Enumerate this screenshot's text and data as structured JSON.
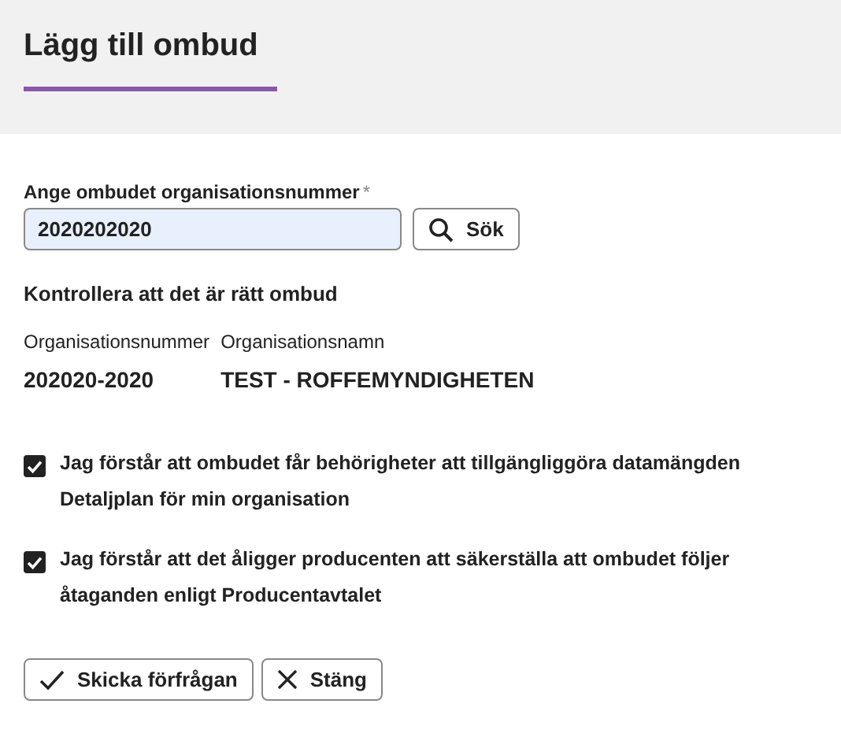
{
  "header": {
    "title": "Lägg till ombud"
  },
  "search": {
    "label": "Ange ombudet organisationsnummer",
    "required_mark": "*",
    "value": "2020202020",
    "button": "Sök"
  },
  "check_heading": "Kontrollera att det är rätt ombud",
  "organisation": {
    "columns": [
      "Organisationsnummer",
      "Organisationsnamn"
    ],
    "values": [
      "202020-2020",
      "TEST - ROFFEMYNDIGHETEN"
    ]
  },
  "confirmations": [
    {
      "text": "Jag förstår att ombudet får behörigheter att tillgängliggöra datamängden Detaljplan för min organisation",
      "checked": true
    },
    {
      "text": "Jag förstår att det åligger producenten att säkerställa att ombudet följer åtaganden enligt Producentavtalet",
      "checked": true
    }
  ],
  "buttons": [
    {
      "kind": "confirm",
      "label": "Skicka förfrågan"
    },
    {
      "kind": "close",
      "label": "Stäng"
    }
  ]
}
